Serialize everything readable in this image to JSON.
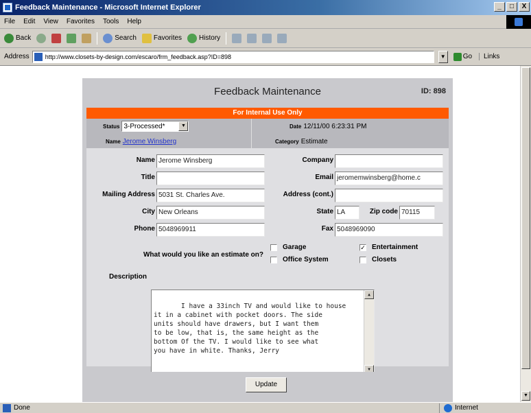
{
  "window": {
    "title": "Feedback Maintenance - Microsoft Internet Explorer",
    "controls": [
      "_",
      "□",
      "X"
    ]
  },
  "menu": [
    "File",
    "Edit",
    "View",
    "Favorites",
    "Tools",
    "Help"
  ],
  "toolbar": {
    "back": "Back",
    "search": "Search",
    "favorites": "Favorites",
    "history": "History"
  },
  "address": {
    "label": "Address",
    "url": "http://www.closets-by-design.com/escaro/frm_feedback.asp?ID=898",
    "go": "Go",
    "links": "Links"
  },
  "panel": {
    "title": "Feedback Maintenance",
    "id": "ID: 898",
    "internal_banner": "For Internal Use Only",
    "status_label": "Status",
    "status_value": "3-Processed*",
    "date_label": "Date",
    "date_value": "12/11/00 6:23:31 PM",
    "name_label": "Name",
    "name_value": "Jerome Winsberg",
    "category_label": "Category",
    "category_value": "Estimate"
  },
  "form": {
    "name_label": "Name",
    "name_value": "Jerome Winsberg",
    "company_label": "Company",
    "company_value": "",
    "title_label": "Title",
    "title_value": "",
    "email_label": "Email",
    "email_value": "jeromemwinsberg@home.c",
    "mailing_label": "Mailing Address",
    "mailing_value": "5031 St. Charles Ave.",
    "address2_label": "Address (cont.)",
    "address2_value": "",
    "city_label": "City",
    "city_value": "New Orleans",
    "state_label": "State",
    "state_value": "LA",
    "zip_label": "Zip code",
    "zip_value": "70115",
    "phone_label": "Phone",
    "phone_value": "5048969911",
    "fax_label": "Fax",
    "fax_value": "5048969090",
    "estimate_question": "What would you like an estimate on?",
    "options": {
      "garage": "Garage",
      "garage_checked": false,
      "entertainment": "Entertainment",
      "entertainment_checked": true,
      "office": "Office System",
      "office_checked": false,
      "closets": "Closets",
      "closets_checked": false
    },
    "description_label": "Description",
    "description_value": " I have a 33inch TV and would like to house\nit in a cabinet with pocket doors. The side\nunits should have drawers, but I want them\nto be low, that is, the same height as the\nbottom Of the TV. I would like to see what\nyou have in white. Thanks, Jerry",
    "update_button": "Update"
  },
  "status": {
    "left": "Done",
    "right": "Internet"
  }
}
